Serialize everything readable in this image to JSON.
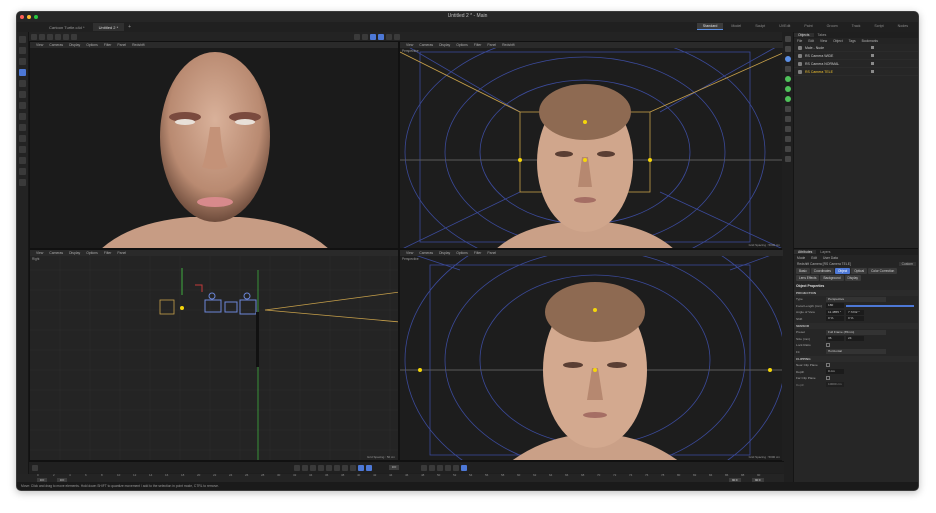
{
  "window": {
    "title": "Untitled 2 * - Main",
    "doc_tabs": [
      "Cartoon Turtle.c4d *",
      "Untitled 2 *"
    ],
    "layouts": [
      "Standard",
      "Model",
      "Sculpt",
      "UVEdit",
      "Paint",
      "Groom",
      "Track",
      "Script",
      "Nodes"
    ]
  },
  "viewports": {
    "menu": [
      "View",
      "Cameras",
      "Display",
      "Options",
      "Filter",
      "Panel",
      "Redshift"
    ],
    "top_left": {
      "label": ""
    },
    "top_right": {
      "label": "Perspective",
      "footer": "Grid Spacing : 5000 cm"
    },
    "bottom_left": {
      "label": "Right",
      "footer": "Grid Spacing : 50 cm"
    },
    "bottom_right": {
      "label": "Perspective",
      "footer": "Grid Spacing : 5000 cm"
    }
  },
  "objects_panel": {
    "tabs": [
      "Objects",
      "Takes"
    ],
    "menu": [
      "File",
      "Edit",
      "View",
      "Object",
      "Tags",
      "Bookmarks"
    ],
    "items": [
      "Male - Nude",
      "RS Camera WIDE",
      "RS Camera NORMAL",
      "RS Camera TELE"
    ]
  },
  "attributes": {
    "tabs": [
      "Attributes",
      "Layers"
    ],
    "menu": [
      "Mode",
      "Edit",
      "User Data"
    ],
    "title": "Redshift Camera [RS Camera TELE]",
    "mode": "Custom",
    "buttons": [
      "Basic",
      "Coordinates",
      "Object",
      "Optical",
      "Color Correction",
      "Lens Effects",
      "Background",
      "Display"
    ],
    "section": "Object Properties",
    "projection": {
      "heading": "PROJECTION",
      "type_label": "Type",
      "type_value": "Perspective",
      "focal_label": "Focal Length (mm)",
      "focal_value": "180",
      "aov_label": "Angle of View",
      "aov_value": "11.4855 °",
      "aov_value2": "7.7232 °",
      "shift_label": "Shift",
      "shift_value": "0 %",
      "shift_value2": "0 %"
    },
    "sensor": {
      "heading": "SENSOR",
      "preset_label": "Preset",
      "preset_value": "Full Frame (35mm)",
      "size_label": "Size (mm)",
      "size_value": "36",
      "size_value2": "24",
      "lock_label": "Lock Ratio",
      "fit_label": "Fit",
      "fit_value": "Horizontal"
    },
    "clipping": {
      "heading": "CLIPPING",
      "near_label": "Near Clip Plane",
      "depth_label": "Depth",
      "depth_value": "0 cm",
      "far_label": "Far Clip Plane",
      "depth2_label": "Depth",
      "depth2_value": "10000 cm"
    }
  },
  "timeline": {
    "frame": "0 F",
    "start": "0 F",
    "start2": "0 F",
    "end": "90 F",
    "end2": "90 F",
    "ticks": [
      "0",
      "2",
      "4",
      "6",
      "8",
      "10",
      "12",
      "14",
      "16",
      "18",
      "20",
      "22",
      "24",
      "26",
      "28",
      "30",
      "32",
      "34",
      "36",
      "38",
      "40",
      "42",
      "44",
      "46",
      "48",
      "50",
      "52",
      "54",
      "56",
      "58",
      "60",
      "62",
      "64",
      "66",
      "68",
      "70",
      "72",
      "74",
      "76",
      "78",
      "80",
      "82",
      "84",
      "86",
      "88",
      "90"
    ]
  },
  "status": "Move: Click and drag to move elements. Hold down SHIFT to quantize movement / add to the selection in point mode, CTRL to remove."
}
